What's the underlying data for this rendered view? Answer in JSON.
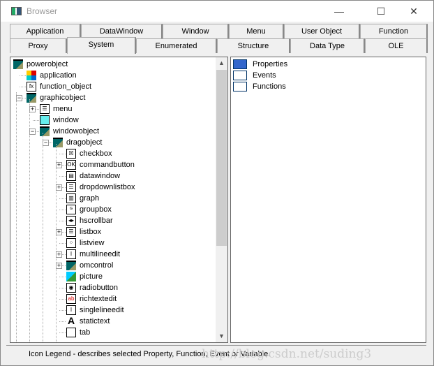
{
  "window": {
    "title": "Browser",
    "minimize": "—",
    "maximize": "☐",
    "close": "✕"
  },
  "tabs_row1": [
    "Application",
    "DataWindow",
    "Window",
    "Menu",
    "User Object",
    "Function"
  ],
  "tabs_row2": [
    "Proxy",
    "System",
    "Enumerated",
    "Structure",
    "Data Type",
    "OLE"
  ],
  "selected_tab": "System",
  "tree": [
    {
      "label": "powerobject",
      "level": 0,
      "icon": "cube-icon",
      "expander": ""
    },
    {
      "label": "application",
      "level": 1,
      "icon": "application-icon",
      "expander": ""
    },
    {
      "label": "function_object",
      "level": 1,
      "icon": "function-icon",
      "expander": ""
    },
    {
      "label": "graphicobject",
      "level": 1,
      "icon": "cube-icon",
      "expander": "−"
    },
    {
      "label": "menu",
      "level": 2,
      "icon": "menu-icon",
      "expander": "+"
    },
    {
      "label": "window",
      "level": 2,
      "icon": "window-icon",
      "expander": ""
    },
    {
      "label": "windowobject",
      "level": 2,
      "icon": "cube-icon",
      "expander": "−"
    },
    {
      "label": "dragobject",
      "level": 3,
      "icon": "cube-icon",
      "expander": "−"
    },
    {
      "label": "checkbox",
      "level": 4,
      "icon": "checkbox-icon",
      "expander": ""
    },
    {
      "label": "commandbutton",
      "level": 4,
      "icon": "commandbutton-icon",
      "expander": "+"
    },
    {
      "label": "datawindow",
      "level": 4,
      "icon": "datawindow-icon",
      "expander": ""
    },
    {
      "label": "dropdownlistbox",
      "level": 4,
      "icon": "dropdownlistbox-icon",
      "expander": "+"
    },
    {
      "label": "graph",
      "level": 4,
      "icon": "graph-icon",
      "expander": ""
    },
    {
      "label": "groupbox",
      "level": 4,
      "icon": "groupbox-icon",
      "expander": ""
    },
    {
      "label": "hscrollbar",
      "level": 4,
      "icon": "hscrollbar-icon",
      "expander": ""
    },
    {
      "label": "listbox",
      "level": 4,
      "icon": "listbox-icon",
      "expander": "+"
    },
    {
      "label": "listview",
      "level": 4,
      "icon": "listview-icon",
      "expander": ""
    },
    {
      "label": "multilineedit",
      "level": 4,
      "icon": "multilineedit-icon",
      "expander": "+"
    },
    {
      "label": "omcontrol",
      "level": 4,
      "icon": "cube-icon",
      "expander": "+"
    },
    {
      "label": "picture",
      "level": 4,
      "icon": "picture-icon",
      "expander": ""
    },
    {
      "label": "radiobutton",
      "level": 4,
      "icon": "radiobutton-icon",
      "expander": ""
    },
    {
      "label": "richtextedit",
      "level": 4,
      "icon": "richtextedit-icon",
      "expander": ""
    },
    {
      "label": "singlelineedit",
      "level": 4,
      "icon": "singlelineedit-icon",
      "expander": ""
    },
    {
      "label": "statictext",
      "level": 4,
      "icon": "statictext-icon",
      "expander": ""
    },
    {
      "label": "tab",
      "level": 4,
      "icon": "tab-icon",
      "expander": ""
    }
  ],
  "members": [
    {
      "label": "Properties",
      "icon": "properties-icon"
    },
    {
      "label": "Events",
      "icon": "events-icon"
    },
    {
      "label": "Functions",
      "icon": "functions-icon"
    }
  ],
  "status": "Icon Legend - describes selected Property, Function, Event or Variable.",
  "watermark": "http://blog.csdn.net/suding3"
}
